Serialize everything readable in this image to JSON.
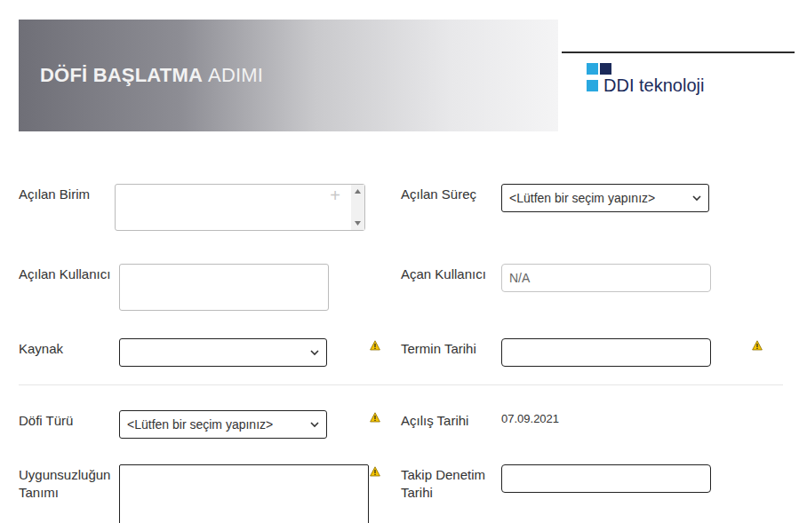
{
  "header": {
    "title_bold": "DÖFİ BAŞLATMA",
    "title_light": "ADIMI",
    "logo": {
      "brand": "DDI",
      "suffix": "teknoloji"
    }
  },
  "rows": [
    {
      "divider_before": false,
      "fields": [
        {
          "label": "Açılan Birim",
          "kind": "listbox",
          "value": "",
          "button": "+",
          "required": false,
          "readonly": false
        },
        {
          "label": "Açılan Süreç",
          "kind": "select",
          "value": "<Lütfen bir seçim yapınız>",
          "required": false,
          "readonly": false
        }
      ]
    },
    {
      "divider_before": false,
      "fields": [
        {
          "label": "Açılan Kullanıcı",
          "kind": "textarea",
          "value": "",
          "required": false,
          "readonly": false
        },
        {
          "label": "Açan Kullanıcı",
          "kind": "input",
          "value": "N/A",
          "required": false,
          "readonly": true
        }
      ]
    },
    {
      "divider_before": false,
      "fields": [
        {
          "label": "Kaynak",
          "kind": "select",
          "value": "",
          "required": true,
          "readonly": false
        },
        {
          "label": "Termin Tarihi",
          "kind": "input",
          "value": "",
          "required": true,
          "readonly": false
        }
      ]
    },
    {
      "divider_before": true,
      "fields": [
        {
          "label": "Döfi Türü",
          "kind": "select",
          "value": "<Lütfen bir seçim yapınız>",
          "required": true,
          "readonly": false
        },
        {
          "label": "Açılış Tarihi",
          "kind": "text",
          "value": "07.09.2021",
          "required": false,
          "readonly": false
        }
      ]
    },
    {
      "divider_before": false,
      "fields": [
        {
          "label": "Uygunsuzluğun Tanımı",
          "kind": "longtext",
          "value": "",
          "required": true,
          "readonly": false
        },
        {
          "label": "Takip Denetim Tarihi",
          "kind": "input",
          "value": "",
          "required": false,
          "readonly": false
        }
      ]
    }
  ]
}
